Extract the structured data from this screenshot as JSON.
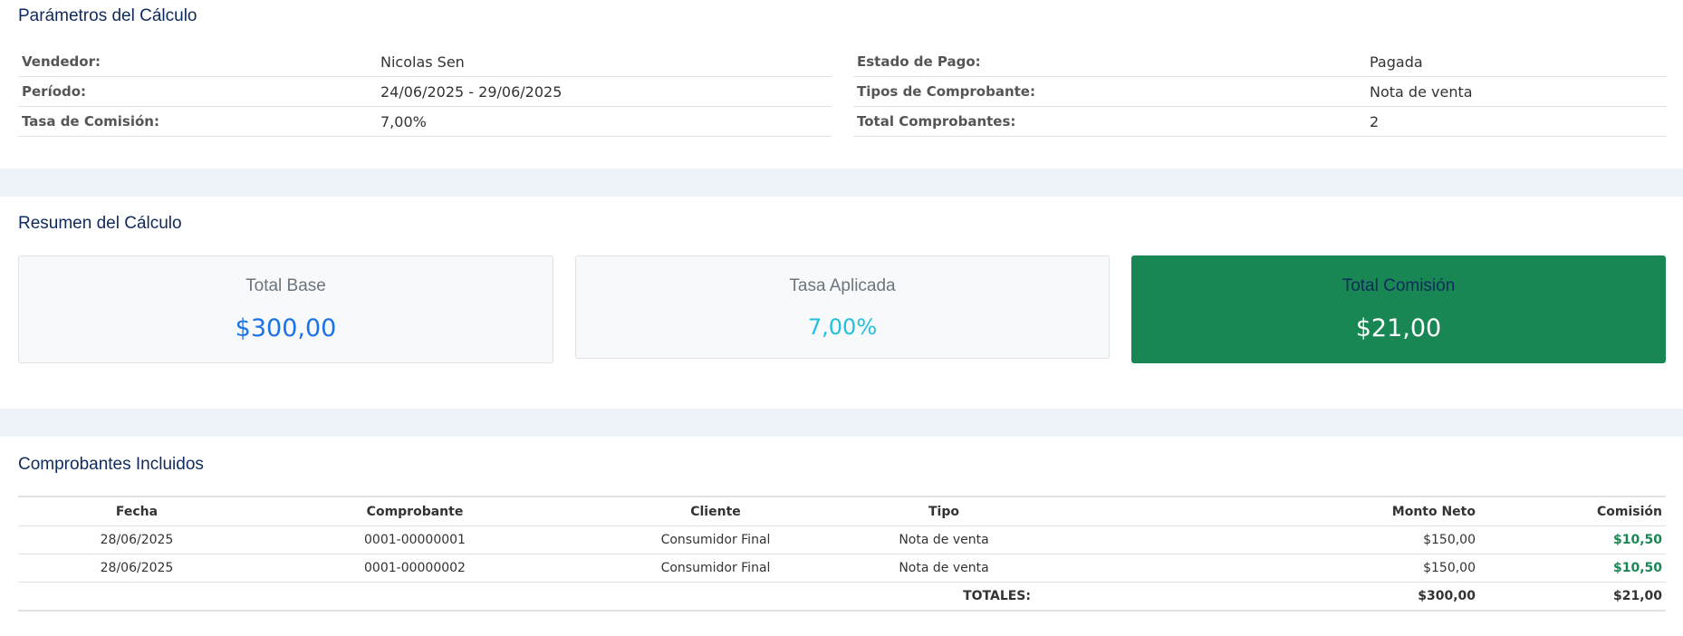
{
  "params": {
    "title": "Parámetros del Cálculo",
    "left": [
      {
        "label": "Vendedor:",
        "value": "Nicolas Sen"
      },
      {
        "label": "Período:",
        "value": "24/06/2025 - 29/06/2025"
      },
      {
        "label": "Tasa de Comisión:",
        "value": "7,00%"
      }
    ],
    "right": [
      {
        "label": "Estado de Pago:",
        "value": "Pagada"
      },
      {
        "label": "Tipos de Comprobante:",
        "value": "Nota de venta"
      },
      {
        "label": "Total Comprobantes:",
        "value": "2"
      }
    ]
  },
  "summary": {
    "title": "Resumen del Cálculo",
    "total_base": {
      "label": "Total Base",
      "value": "$300,00"
    },
    "tasa": {
      "label": "Tasa Aplicada",
      "value": "7,00%"
    },
    "total_comision": {
      "label": "Total Comisión",
      "value": "$21,00"
    }
  },
  "table": {
    "title": "Comprobantes Incluidos",
    "headers": [
      "Fecha",
      "Comprobante",
      "Cliente",
      "Tipo",
      "Monto Neto",
      "Comisión"
    ],
    "rows": [
      [
        "28/06/2025",
        "0001-00000001",
        "Consumidor Final",
        "Nota de venta",
        "$150,00",
        "$10,50"
      ],
      [
        "28/06/2025",
        "0001-00000002",
        "Consumidor Final",
        "Nota de venta",
        "$150,00",
        "$10,50"
      ]
    ],
    "totals": {
      "label": "TOTALES:",
      "monto": "$300,00",
      "comision": "$21,00"
    }
  },
  "colors": {
    "accent": "#0f2a5c",
    "success": "#198754",
    "primary": "#1a73e8",
    "info": "#22c0de"
  }
}
